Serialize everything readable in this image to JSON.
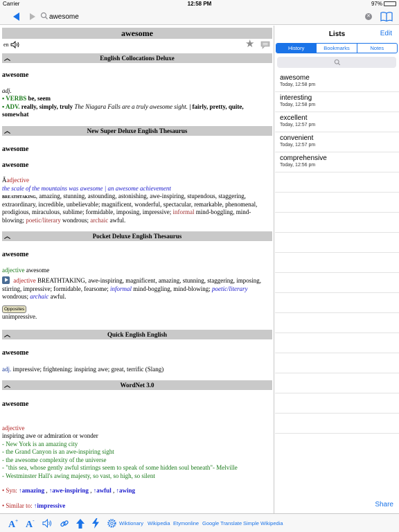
{
  "status": {
    "carrier": "Carrier",
    "time": "12:58 PM",
    "battery": "97%",
    "battery_level": 0.97
  },
  "search": {
    "query": "awesome"
  },
  "entry": {
    "word": "awesome",
    "lang": "en",
    "sections": {
      "s1": {
        "title": "English Collocations Deluxe",
        "headword": "awesome",
        "pos": "adj.",
        "verbs_label": "VERBS",
        "verbs": "be, seem",
        "adv_label": "ADV.",
        "adv_words": "really, simply, truly",
        "adv_example": "The Niagara Falls are a truly awesome sight.",
        "adv_more": "| fairly, pretty, quite, somewhat"
      },
      "s2": {
        "title": "New Super Deluxe English Thesaurus",
        "headword1": "awesome",
        "headword2": "awesome",
        "prefix": "Ã",
        "pos": "adjective",
        "example": "the scale of the mountains was awesome | an awesome achievement",
        "key": "breathtaking",
        "syn1": ", amazing, stunning, astounding, astonishing, awe-inspiring, stupendous, staggering, extraordinary, incredible, unbelievable; magnificent, wonderful, spectacular, remarkable, phenomenal, prodigious, miraculous, sublime; formidable, imposing, impressive;",
        "informal": "informal",
        "syn2": "mind-boggling, mind-blowing;",
        "poetic": "poetic/literary",
        "syn3": "wondrous;",
        "archaic": "archaic",
        "syn4": "awful."
      },
      "s3": {
        "title": "Pocket Deluxe English Thesaurus",
        "headword": "awesome",
        "pos_line_pos": "adjective",
        "pos_line_word": "awesome",
        "pos2": "adjective",
        "syn1": "BREATHTAKING, awe-inspiring, magnificent, amazing, stunning, staggering, imposing, stirring, impressive; formidable, fearsome;",
        "informal": "informal",
        "syn2": "mind-boggling, mind-blowing;",
        "poetic": "poetic/literary",
        "syn3": "wondrous;",
        "archaic": "archaic",
        "syn4": "awful.",
        "opposites_label": "Opposites",
        "opposite": "unimpressive."
      },
      "s4": {
        "title": "Quick English English",
        "headword": "awesome",
        "pos": "adj.",
        "def": "impressive; frightening; inspiring awe; great, terrific (Slang)"
      },
      "s5": {
        "title": "WordNet 3.0",
        "headword": "awesome",
        "pos": "adjective",
        "def": "inspiring awe or admiration or wonder",
        "examples": [
          "- New York is an amazing city",
          "- the Grand Canyon is an awe-inspiring sight",
          "- the awesome complexity of the universe",
          "- \"this sea, whose gently awful stirrings seem to speak of some hidden soul beneath\"- Melville",
          "- Westminster Hall's awing majesty, so vast, so high, so silent"
        ],
        "syn_label": "• Syn:",
        "syn_words": [
          "↑amazing",
          "↑awe-inspiring",
          "↑awful",
          "↑awing"
        ],
        "similar_label": "• Similar to:",
        "similar_word": "↑impressive"
      }
    }
  },
  "lists": {
    "title": "Lists",
    "edit": "Edit",
    "tabs": [
      "History",
      "Bookmarks",
      "Notes"
    ],
    "items": [
      {
        "word": "awesome",
        "time": "Today, 12:58 pm"
      },
      {
        "word": "interesting",
        "time": "Today, 12:58 pm"
      },
      {
        "word": "excellent",
        "time": "Today, 12:57 pm"
      },
      {
        "word": "convenient",
        "time": "Today, 12:57 pm"
      },
      {
        "word": "comprehensive",
        "time": "Today, 12:56 pm"
      }
    ],
    "share": "Share"
  },
  "toolbar": {
    "links": [
      "Wiktionary",
      "Wikipedia",
      "Etymonline",
      "Google Translate",
      "Simple Wikipedia"
    ]
  },
  "colors": {
    "accent": "#1a73e8",
    "header_gray": "#c9c9c9"
  },
  "icons": [
    "back-arrow-icon",
    "forward-arrow-icon",
    "search-icon",
    "clear-icon",
    "book-icon",
    "speaker-icon",
    "star-icon",
    "comment-icon",
    "font-increase-icon",
    "font-decrease-icon",
    "link-icon",
    "up-arrow-icon",
    "lightning-icon",
    "gear-icon",
    "play-icon"
  ]
}
